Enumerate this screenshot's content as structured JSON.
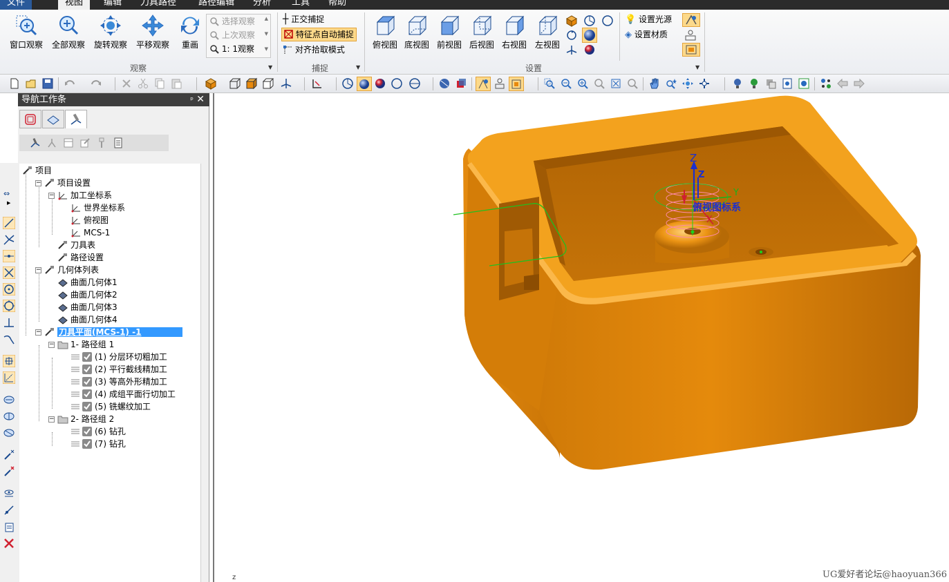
{
  "menubar": {
    "items": [
      "文件",
      "视图",
      "编辑",
      "刀具路径",
      "路径编辑",
      "分析",
      "工具",
      "帮助"
    ]
  },
  "ribbon": {
    "observe": {
      "buttons": [
        "窗口观察",
        "全部观察",
        "旋转观察",
        "平移观察",
        "重画"
      ],
      "list": [
        "选择观察",
        "上次观察",
        "1: 1观察"
      ],
      "group_label": "观察"
    },
    "snap": {
      "items": [
        "正交捕捉",
        "特征点自动捕捉",
        "对齐拾取模式"
      ],
      "group_label": "捕捉"
    },
    "setup": {
      "views": [
        "俯视图",
        "底视图",
        "前视图",
        "后视图",
        "右视图",
        "左视图"
      ],
      "light": "设置光源",
      "material": "设置材质",
      "group_label": "设置"
    }
  },
  "nav": {
    "title": "导航工作条",
    "pin": "ᵖ",
    "close": "✕",
    "tree": [
      {
        "label": "项目",
        "level": 0
      },
      {
        "label": "项目设置",
        "level": 1
      },
      {
        "label": "加工坐标系",
        "level": 2
      },
      {
        "label": "世界坐标系",
        "level": 3
      },
      {
        "label": "俯视图",
        "level": 3
      },
      {
        "label": "MCS-1",
        "level": 3
      },
      {
        "label": "刀具表",
        "level": 2
      },
      {
        "label": "路径设置",
        "level": 2
      },
      {
        "label": "几何体列表",
        "level": 1
      },
      {
        "label": "曲面几何体1",
        "level": 2
      },
      {
        "label": "曲面几何体2",
        "level": 2
      },
      {
        "label": "曲面几何体3",
        "level": 2
      },
      {
        "label": "曲面几何体4",
        "level": 2
      },
      {
        "label": "刀具平面(MCS-1) -1",
        "level": 1
      },
      {
        "label": "1- 路径组 1",
        "level": 2
      },
      {
        "label": "(1) 分层环切粗加工",
        "level": 3
      },
      {
        "label": "(2) 平行截线精加工",
        "level": 3
      },
      {
        "label": "(3) 等高外形精加工",
        "level": 3
      },
      {
        "label": "(4) 成组平面行切加工",
        "level": 3
      },
      {
        "label": "(5) 铣螺纹加工",
        "level": 3
      },
      {
        "label": "2- 路径组 2",
        "level": 2
      },
      {
        "label": "(6) 钻孔",
        "level": 3
      },
      {
        "label": "(7) 钻孔",
        "level": 3
      }
    ]
  },
  "viewport": {
    "axis_z": "Z",
    "axis_y": "Y",
    "axis_x": "X",
    "axis_z2": "Z",
    "csys_label": "俯视图标系",
    "corner_z": "z",
    "watermark": "UG爱好者论坛@haoyuan366"
  },
  "colors": {
    "part_orange": "#e8890c",
    "part_dark": "#b86a05",
    "selection": "#3399ff"
  }
}
